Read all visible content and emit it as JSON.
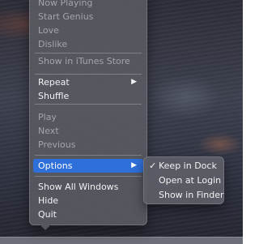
{
  "menu": {
    "items": [
      {
        "label": "Now Playing",
        "disabled": true
      },
      {
        "label": "Start Genius",
        "disabled": true
      },
      {
        "label": "Love",
        "disabled": true
      },
      {
        "label": "Dislike",
        "disabled": true
      },
      {
        "label": "Show in iTunes Store",
        "disabled": true
      },
      {
        "label": "Repeat",
        "disabled": false,
        "submenu_arrow": "▶"
      },
      {
        "label": "Shuffle",
        "disabled": false
      },
      {
        "label": "Play",
        "disabled": true
      },
      {
        "label": "Next",
        "disabled": true
      },
      {
        "label": "Previous",
        "disabled": true
      },
      {
        "label": "Options",
        "disabled": false,
        "selected": true,
        "submenu_arrow": "▶"
      },
      {
        "label": "Show All Windows",
        "disabled": false
      },
      {
        "label": "Hide",
        "disabled": false
      },
      {
        "label": "Quit",
        "disabled": false
      }
    ]
  },
  "options_submenu": {
    "items": [
      {
        "label": "Keep in Dock",
        "checked": true,
        "check_glyph": "✓"
      },
      {
        "label": "Open at Login",
        "checked": false
      },
      {
        "label": "Show in Finder",
        "checked": false
      }
    ]
  },
  "colors": {
    "menu_background": "#585a62",
    "selection_highlight": "#2f6fd9",
    "text": "#f2f2f4",
    "disabled_text": "#a3a5ad"
  }
}
